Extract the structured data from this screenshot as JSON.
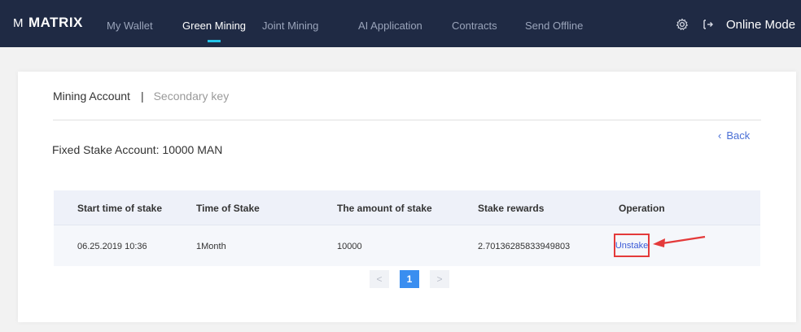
{
  "app": {
    "logo_mark": "M",
    "logo_text": "MATRIX"
  },
  "nav": {
    "items": [
      {
        "label": "My Wallet"
      },
      {
        "label": "Green Mining"
      },
      {
        "label": "Joint Mining"
      },
      {
        "label": "AI Application"
      },
      {
        "label": "Contracts"
      },
      {
        "label": "Send Offline"
      }
    ],
    "active_index": 1,
    "mode_label": "Online Mode",
    "icons": [
      "gear-icon",
      "logout-icon"
    ]
  },
  "tabs": {
    "active": "Mining Account",
    "separator": "|",
    "inactive": "Secondary key"
  },
  "back_label": "Back",
  "account_line": "Fixed Stake Account: 10000 MAN",
  "table": {
    "headers": [
      "Start time of stake",
      "Time of Stake",
      "The amount of stake",
      "Stake rewards",
      "Operation"
    ],
    "rows": [
      {
        "start": "06.25.2019 10:36",
        "duration": "1Month",
        "amount": "10000",
        "rewards": "2.70136285833949803",
        "operation": "Unstake"
      }
    ]
  },
  "pagination": {
    "prev": "<",
    "current": "1",
    "next": ">"
  },
  "colors": {
    "nav_bg": "#1f2a44",
    "accent": "#23c4e8",
    "highlight": "#e43a3a",
    "link": "#3a5ad6",
    "page_active": "#3a8ef0"
  }
}
